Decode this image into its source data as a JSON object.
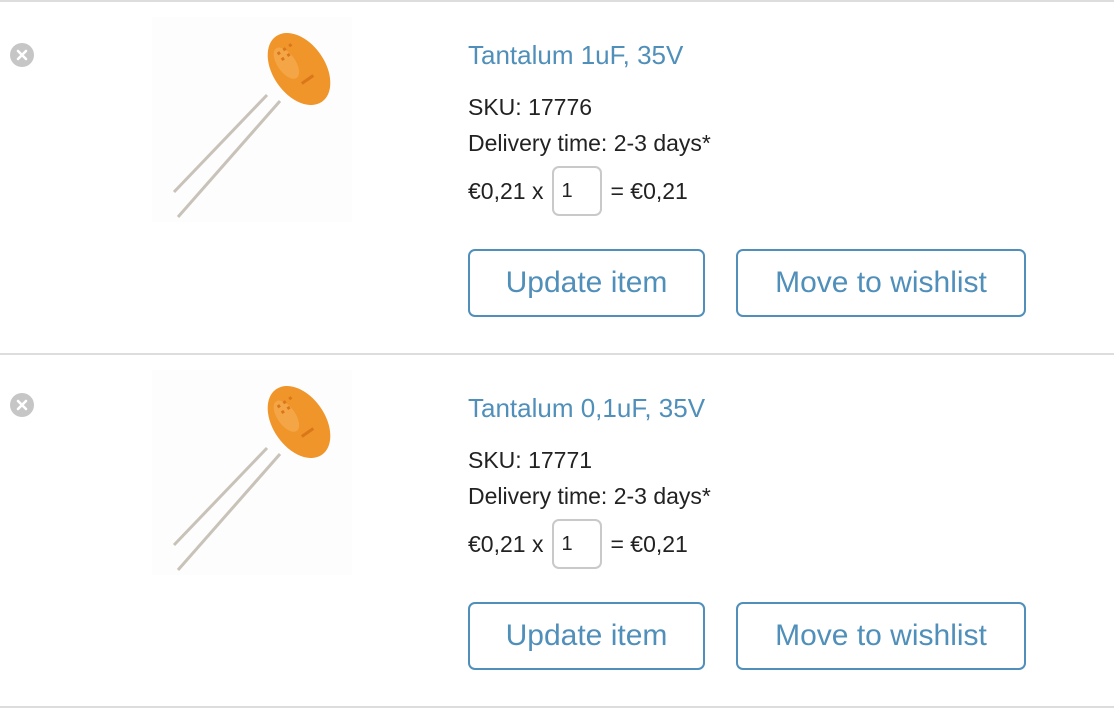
{
  "cart": {
    "items": [
      {
        "title": "Tantalum 1uF, 35V",
        "sku_text": "SKU: 17776",
        "delivery_text": "Delivery time: 2-3 days*",
        "unit_price": "€0,21 x",
        "quantity": "1",
        "total": "= €0,21",
        "update_label": "Update item",
        "wishlist_label": "Move to wishlist"
      },
      {
        "title": "Tantalum 0,1uF, 35V",
        "sku_text": "SKU: 17771",
        "delivery_text": "Delivery time: 2-3 days*",
        "unit_price": "€0,21 x",
        "quantity": "1",
        "total": "= €0,21",
        "update_label": "Update item",
        "wishlist_label": "Move to wishlist"
      }
    ]
  },
  "icons": {
    "remove": "close-circle-icon",
    "product": "tantalum-capacitor-image"
  },
  "colors": {
    "link": "#4f8fba",
    "border": "#4f8fba",
    "divider": "#dddddd",
    "remove_icon": "#c6c6c6",
    "capacitor_body": "#f0952a"
  }
}
